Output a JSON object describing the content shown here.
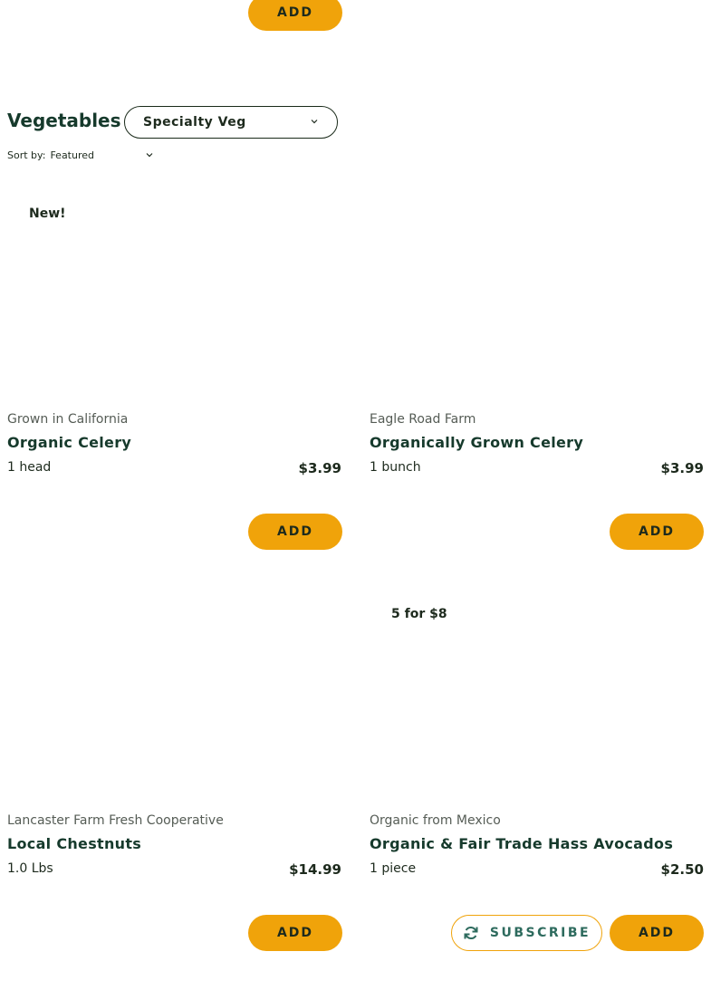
{
  "top_add_label": "ADD",
  "section": {
    "title": "Vegetables",
    "category_select": "Specialty Veg",
    "sort_label": "Sort by:",
    "sort_value": "Featured"
  },
  "products": [
    {
      "badge": "New!",
      "farm": "Grown in California",
      "name": "Organic Celery",
      "unit": "1 head",
      "price": "$3.99",
      "add_label": "ADD"
    },
    {
      "badge": "",
      "farm": "Eagle Road Farm",
      "name": "Organically Grown Celery",
      "unit": "1 bunch",
      "price": "$3.99",
      "add_label": "ADD"
    },
    {
      "badge": "",
      "farm": "Lancaster Farm Fresh Cooperative",
      "name": "Local Chestnuts",
      "unit": "1.0 Lbs",
      "price": "$14.99",
      "add_label": "ADD"
    },
    {
      "badge": "5 for $8",
      "farm": "Organic from Mexico",
      "name": "Organic & Fair Trade Hass Avocados",
      "unit": "1 piece",
      "price": "$2.50",
      "add_label": "ADD",
      "subscribe_label": "SUBSCRIBE"
    }
  ],
  "colors": {
    "accent": "#f0a30a",
    "heading": "#163a2c",
    "subscribe_text": "#2e6b5e"
  },
  "icons": {
    "dropdown": "chevron-down-icon",
    "subscribe": "refresh-icon"
  }
}
